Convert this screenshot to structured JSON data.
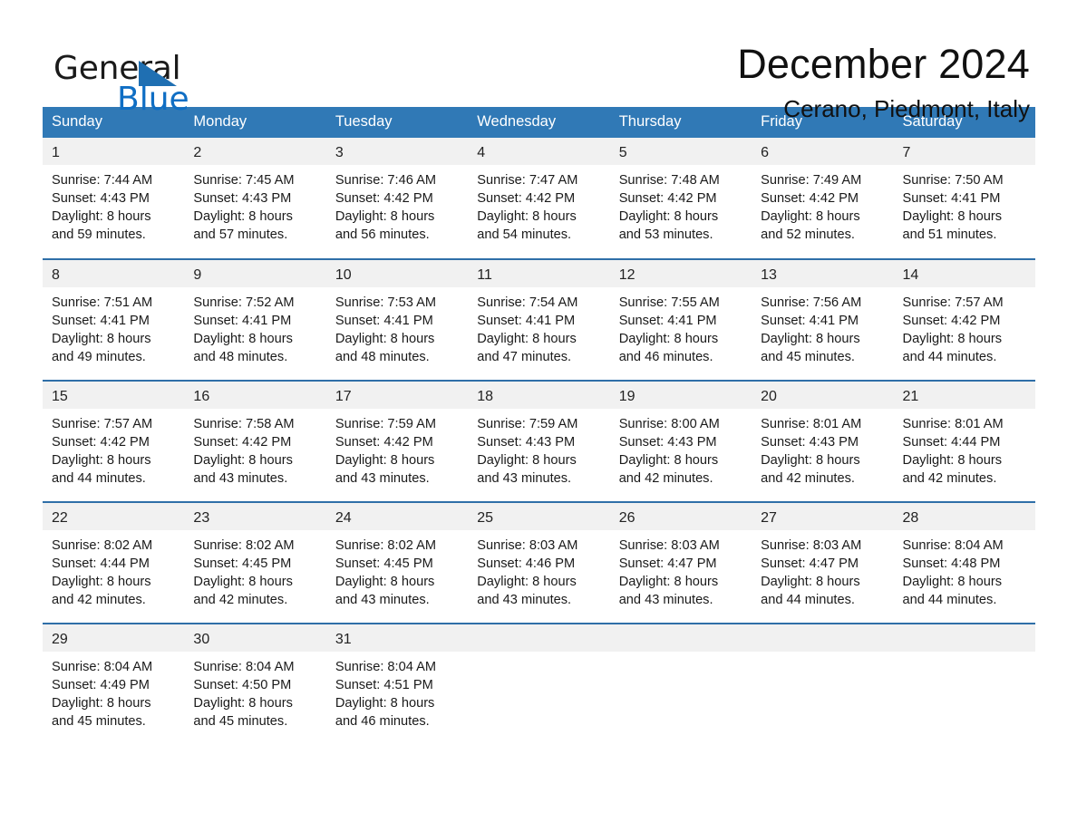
{
  "brand": {
    "name_part1": "General",
    "name_part2": "Blue",
    "accent_color": "#1f6fb2"
  },
  "header": {
    "month_title": "December 2024",
    "location": "Cerano, Piedmont, Italy"
  },
  "calendar": {
    "header_background": "#3079b6",
    "daynum_background": "#f1f1f1",
    "row_border_color": "#2f6fa8",
    "weekday_headers": [
      "Sunday",
      "Monday",
      "Tuesday",
      "Wednesday",
      "Thursday",
      "Friday",
      "Saturday"
    ],
    "weeks": [
      [
        {
          "day": "1",
          "sunrise": "Sunrise: 7:44 AM",
          "sunset": "Sunset: 4:43 PM",
          "daylight_line1": "Daylight: 8 hours",
          "daylight_line2": "and 59 minutes."
        },
        {
          "day": "2",
          "sunrise": "Sunrise: 7:45 AM",
          "sunset": "Sunset: 4:43 PM",
          "daylight_line1": "Daylight: 8 hours",
          "daylight_line2": "and 57 minutes."
        },
        {
          "day": "3",
          "sunrise": "Sunrise: 7:46 AM",
          "sunset": "Sunset: 4:42 PM",
          "daylight_line1": "Daylight: 8 hours",
          "daylight_line2": "and 56 minutes."
        },
        {
          "day": "4",
          "sunrise": "Sunrise: 7:47 AM",
          "sunset": "Sunset: 4:42 PM",
          "daylight_line1": "Daylight: 8 hours",
          "daylight_line2": "and 54 minutes."
        },
        {
          "day": "5",
          "sunrise": "Sunrise: 7:48 AM",
          "sunset": "Sunset: 4:42 PM",
          "daylight_line1": "Daylight: 8 hours",
          "daylight_line2": "and 53 minutes."
        },
        {
          "day": "6",
          "sunrise": "Sunrise: 7:49 AM",
          "sunset": "Sunset: 4:42 PM",
          "daylight_line1": "Daylight: 8 hours",
          "daylight_line2": "and 52 minutes."
        },
        {
          "day": "7",
          "sunrise": "Sunrise: 7:50 AM",
          "sunset": "Sunset: 4:41 PM",
          "daylight_line1": "Daylight: 8 hours",
          "daylight_line2": "and 51 minutes."
        }
      ],
      [
        {
          "day": "8",
          "sunrise": "Sunrise: 7:51 AM",
          "sunset": "Sunset: 4:41 PM",
          "daylight_line1": "Daylight: 8 hours",
          "daylight_line2": "and 49 minutes."
        },
        {
          "day": "9",
          "sunrise": "Sunrise: 7:52 AM",
          "sunset": "Sunset: 4:41 PM",
          "daylight_line1": "Daylight: 8 hours",
          "daylight_line2": "and 48 minutes."
        },
        {
          "day": "10",
          "sunrise": "Sunrise: 7:53 AM",
          "sunset": "Sunset: 4:41 PM",
          "daylight_line1": "Daylight: 8 hours",
          "daylight_line2": "and 48 minutes."
        },
        {
          "day": "11",
          "sunrise": "Sunrise: 7:54 AM",
          "sunset": "Sunset: 4:41 PM",
          "daylight_line1": "Daylight: 8 hours",
          "daylight_line2": "and 47 minutes."
        },
        {
          "day": "12",
          "sunrise": "Sunrise: 7:55 AM",
          "sunset": "Sunset: 4:41 PM",
          "daylight_line1": "Daylight: 8 hours",
          "daylight_line2": "and 46 minutes."
        },
        {
          "day": "13",
          "sunrise": "Sunrise: 7:56 AM",
          "sunset": "Sunset: 4:41 PM",
          "daylight_line1": "Daylight: 8 hours",
          "daylight_line2": "and 45 minutes."
        },
        {
          "day": "14",
          "sunrise": "Sunrise: 7:57 AM",
          "sunset": "Sunset: 4:42 PM",
          "daylight_line1": "Daylight: 8 hours",
          "daylight_line2": "and 44 minutes."
        }
      ],
      [
        {
          "day": "15",
          "sunrise": "Sunrise: 7:57 AM",
          "sunset": "Sunset: 4:42 PM",
          "daylight_line1": "Daylight: 8 hours",
          "daylight_line2": "and 44 minutes."
        },
        {
          "day": "16",
          "sunrise": "Sunrise: 7:58 AM",
          "sunset": "Sunset: 4:42 PM",
          "daylight_line1": "Daylight: 8 hours",
          "daylight_line2": "and 43 minutes."
        },
        {
          "day": "17",
          "sunrise": "Sunrise: 7:59 AM",
          "sunset": "Sunset: 4:42 PM",
          "daylight_line1": "Daylight: 8 hours",
          "daylight_line2": "and 43 minutes."
        },
        {
          "day": "18",
          "sunrise": "Sunrise: 7:59 AM",
          "sunset": "Sunset: 4:43 PM",
          "daylight_line1": "Daylight: 8 hours",
          "daylight_line2": "and 43 minutes."
        },
        {
          "day": "19",
          "sunrise": "Sunrise: 8:00 AM",
          "sunset": "Sunset: 4:43 PM",
          "daylight_line1": "Daylight: 8 hours",
          "daylight_line2": "and 42 minutes."
        },
        {
          "day": "20",
          "sunrise": "Sunrise: 8:01 AM",
          "sunset": "Sunset: 4:43 PM",
          "daylight_line1": "Daylight: 8 hours",
          "daylight_line2": "and 42 minutes."
        },
        {
          "day": "21",
          "sunrise": "Sunrise: 8:01 AM",
          "sunset": "Sunset: 4:44 PM",
          "daylight_line1": "Daylight: 8 hours",
          "daylight_line2": "and 42 minutes."
        }
      ],
      [
        {
          "day": "22",
          "sunrise": "Sunrise: 8:02 AM",
          "sunset": "Sunset: 4:44 PM",
          "daylight_line1": "Daylight: 8 hours",
          "daylight_line2": "and 42 minutes."
        },
        {
          "day": "23",
          "sunrise": "Sunrise: 8:02 AM",
          "sunset": "Sunset: 4:45 PM",
          "daylight_line1": "Daylight: 8 hours",
          "daylight_line2": "and 42 minutes."
        },
        {
          "day": "24",
          "sunrise": "Sunrise: 8:02 AM",
          "sunset": "Sunset: 4:45 PM",
          "daylight_line1": "Daylight: 8 hours",
          "daylight_line2": "and 43 minutes."
        },
        {
          "day": "25",
          "sunrise": "Sunrise: 8:03 AM",
          "sunset": "Sunset: 4:46 PM",
          "daylight_line1": "Daylight: 8 hours",
          "daylight_line2": "and 43 minutes."
        },
        {
          "day": "26",
          "sunrise": "Sunrise: 8:03 AM",
          "sunset": "Sunset: 4:47 PM",
          "daylight_line1": "Daylight: 8 hours",
          "daylight_line2": "and 43 minutes."
        },
        {
          "day": "27",
          "sunrise": "Sunrise: 8:03 AM",
          "sunset": "Sunset: 4:47 PM",
          "daylight_line1": "Daylight: 8 hours",
          "daylight_line2": "and 44 minutes."
        },
        {
          "day": "28",
          "sunrise": "Sunrise: 8:04 AM",
          "sunset": "Sunset: 4:48 PM",
          "daylight_line1": "Daylight: 8 hours",
          "daylight_line2": "and 44 minutes."
        }
      ],
      [
        {
          "day": "29",
          "sunrise": "Sunrise: 8:04 AM",
          "sunset": "Sunset: 4:49 PM",
          "daylight_line1": "Daylight: 8 hours",
          "daylight_line2": "and 45 minutes."
        },
        {
          "day": "30",
          "sunrise": "Sunrise: 8:04 AM",
          "sunset": "Sunset: 4:50 PM",
          "daylight_line1": "Daylight: 8 hours",
          "daylight_line2": "and 45 minutes."
        },
        {
          "day": "31",
          "sunrise": "Sunrise: 8:04 AM",
          "sunset": "Sunset: 4:51 PM",
          "daylight_line1": "Daylight: 8 hours",
          "daylight_line2": "and 46 minutes."
        },
        {
          "day": "",
          "sunrise": "",
          "sunset": "",
          "daylight_line1": "",
          "daylight_line2": ""
        },
        {
          "day": "",
          "sunrise": "",
          "sunset": "",
          "daylight_line1": "",
          "daylight_line2": ""
        },
        {
          "day": "",
          "sunrise": "",
          "sunset": "",
          "daylight_line1": "",
          "daylight_line2": ""
        },
        {
          "day": "",
          "sunrise": "",
          "sunset": "",
          "daylight_line1": "",
          "daylight_line2": ""
        }
      ]
    ]
  }
}
